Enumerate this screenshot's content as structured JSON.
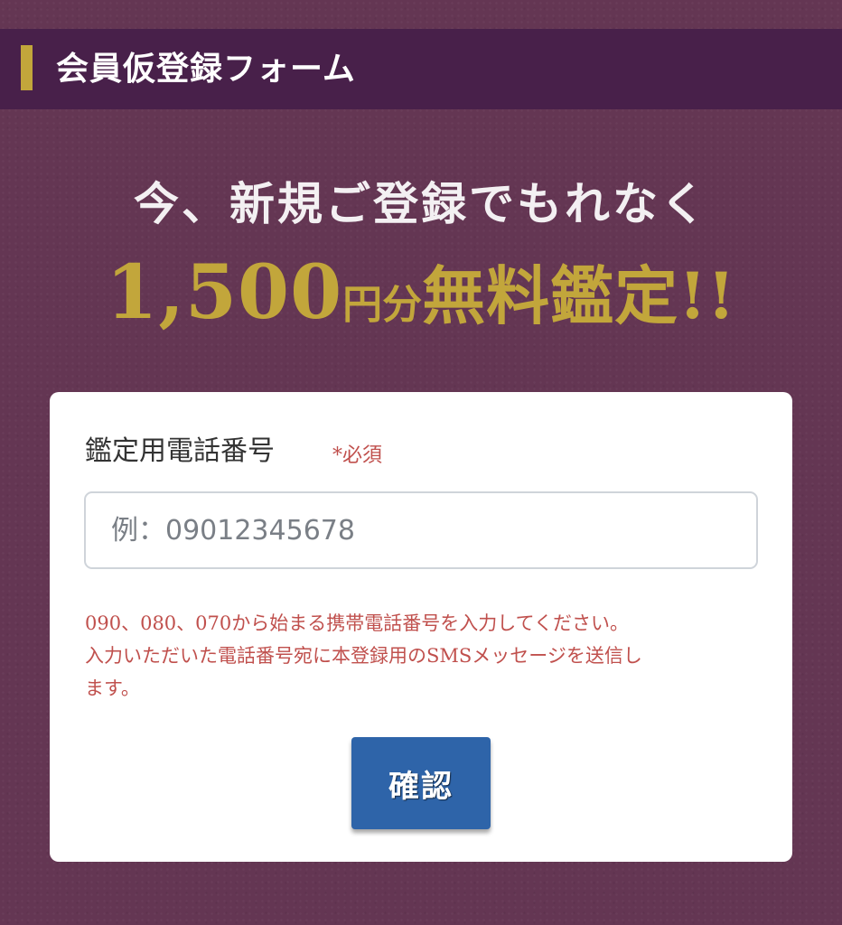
{
  "header": {
    "title": "会員仮登録フォーム"
  },
  "promo": {
    "headline": "今、新規ご登録でもれなく",
    "offer_amount": "1,500",
    "offer_unit": "円分",
    "offer_text": "無料鑑定!!"
  },
  "form": {
    "phone_label": "鑑定用電話番号",
    "required_mark": "*必須",
    "phone_value": "",
    "phone_placeholder": "例：09012345678",
    "note_lines": [
      "090、080、070から始まる携帯電話番号を入力してください。",
      "入力いただいた電話番号宛に本登録用のSMSメッセージを送信し",
      "ます。"
    ],
    "confirm_label": "確認"
  },
  "colors": {
    "background": "#643653",
    "header_bar": "#48204a",
    "accent_gold": "#c2a63b",
    "note_red": "#c0504d",
    "button_blue": "#2e64a9"
  }
}
